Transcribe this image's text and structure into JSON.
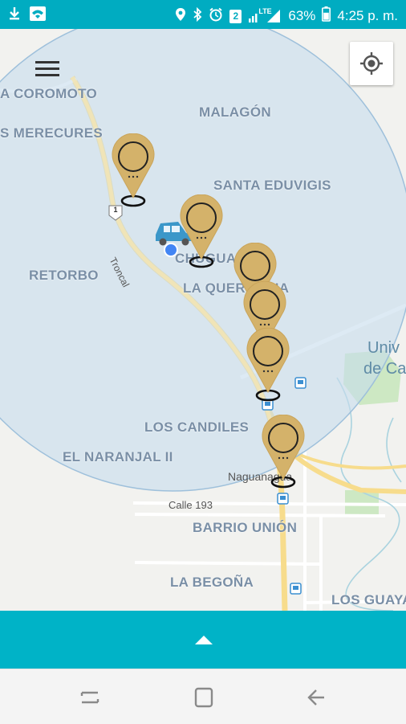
{
  "status_bar": {
    "battery_text": "63%",
    "time": "4:25 p. m.",
    "sim_badge": "2",
    "network_type": "LTE",
    "icons_left": [
      "download-icon",
      "wifi-icon"
    ],
    "icons_right": [
      "location-icon",
      "bluetooth-icon",
      "alarm-icon",
      "sim-icon",
      "signal-icon",
      "battery-icon"
    ]
  },
  "map": {
    "places": {
      "coromoto": "A COROMOTO",
      "malagon": "MALAGÓN",
      "merecures": "S MERECURES",
      "santa_eduvigis": "SANTA EDUVIGIS",
      "retorbo": "RETORBO",
      "chuguantal": "CHUGUANTAL",
      "la_querencia": "LA QUERENCIA",
      "los_candiles": "LOS CANDILES",
      "el_naranjal": "EL NARANJAL II",
      "barrio_union": "BARRIO UNIÓN",
      "la_begona": "LA BEGOÑA",
      "los_guayabos": "LOS GUAYA"
    },
    "university_line1": "Univ",
    "university_line2": "de Ca",
    "road_troncal": "Troncal",
    "road_shield": "1",
    "street_calle": "Calle 193",
    "street_naguanagua": "Naguanagua",
    "accent_color": "#00acc1",
    "pin_color": "#d4b26a",
    "radius_fill": "#c6dcec"
  },
  "controls": {
    "menu_icon": "menu-icon",
    "locate_icon": "my-location-icon",
    "expand_icon": "chevron-up-icon"
  },
  "navbar": {
    "recents_icon": "recents-icon",
    "home_icon": "home-icon",
    "back_icon": "back-icon"
  }
}
